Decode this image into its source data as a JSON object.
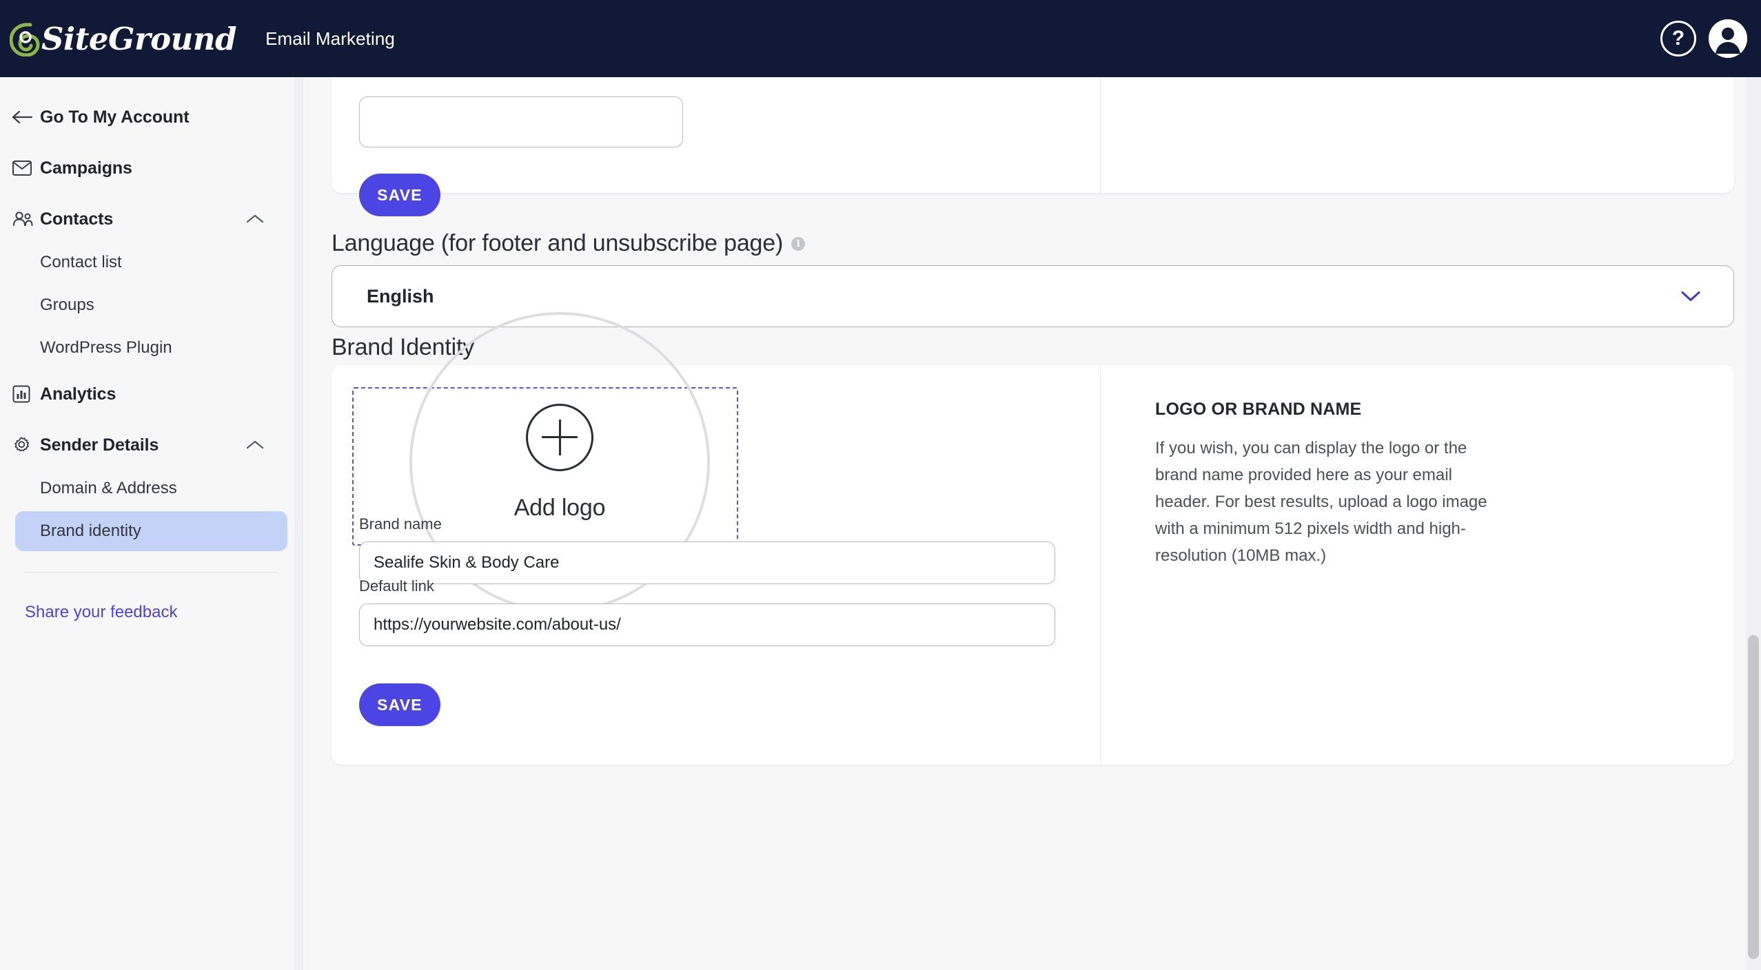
{
  "topbar": {
    "logo_text": "SiteGround",
    "app_title": "Email Marketing",
    "help_icon": "help-question-icon",
    "avatar_icon": "user-avatar-icon"
  },
  "sidebar": {
    "back_label": "Go To My Account",
    "items": [
      {
        "label": "Campaigns",
        "icon": "envelope-icon",
        "expandable": false
      },
      {
        "label": "Contacts",
        "icon": "people-icon",
        "expandable": true,
        "expanded": true
      },
      {
        "label": "Analytics",
        "icon": "bar-chart-icon",
        "expandable": false
      },
      {
        "label": "Sender Details",
        "icon": "gear-icon",
        "expandable": true,
        "expanded": true
      }
    ],
    "contacts_children": [
      "Contact list",
      "Groups",
      "WordPress Plugin"
    ],
    "sender_children": [
      "Domain & Address",
      "Brand identity"
    ],
    "active_child": "Brand identity",
    "feedback_label": "Share your feedback"
  },
  "main": {
    "top_card": {
      "save_label": "SAVE"
    },
    "language_section": {
      "heading": "Language (for footer and unsubscribe page)",
      "info_icon": "info-icon",
      "selected": "English",
      "chevron_icon": "chevron-down-icon"
    },
    "brand_section": {
      "heading": "Brand Identity",
      "logo_uploader": {
        "plus_icon": "plus-circle-icon",
        "label": "Add logo"
      },
      "brand_name": {
        "label": "Brand name",
        "value": "Sealife Skin & Body Care"
      },
      "default_link": {
        "label": "Default link",
        "value": "https://yourwebsite.com/about-us/"
      },
      "save_label": "SAVE",
      "info": {
        "title": "LOGO OR BRAND NAME",
        "body": "If you wish, you can display the logo or the brand name provided here as your email header. For best results, upload a logo image with a minimum 512 pixels width and high-resolution (10MB max.)"
      }
    }
  },
  "colors": {
    "topbar_bg": "#101a36",
    "accent": "#4b45e4",
    "active_nav_bg": "#c3d3f7",
    "page_bg": "#f7f7f8",
    "dropzone_border": "#5c55d8"
  }
}
